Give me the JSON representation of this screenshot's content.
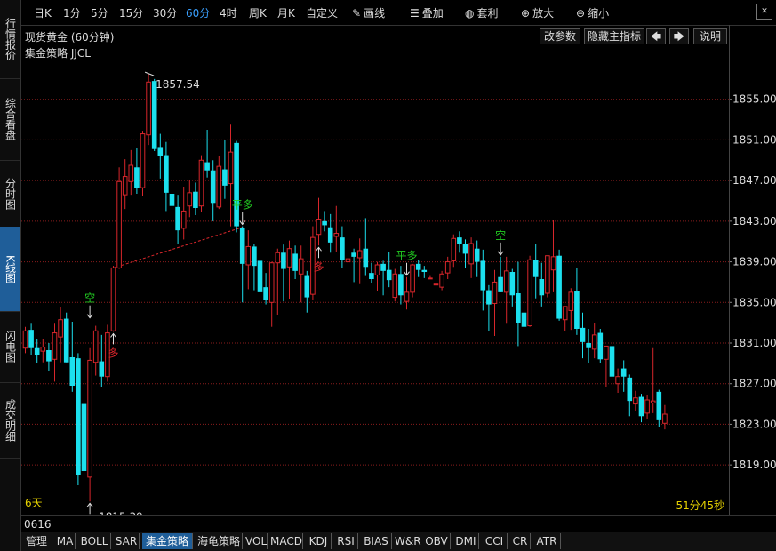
{
  "sidebar": {
    "tabs": [
      {
        "label": "行情报价",
        "active": false
      },
      {
        "label": "综合看盘",
        "active": false
      },
      {
        "label": "分时图",
        "active": false
      },
      {
        "label": "K线图",
        "active": true
      },
      {
        "label": "闪电图",
        "active": false
      },
      {
        "label": "成交明细",
        "active": false
      }
    ]
  },
  "toolbar": {
    "periods": [
      {
        "label": "日K",
        "active": false
      },
      {
        "label": "1分",
        "active": false
      },
      {
        "label": "5分",
        "active": false
      },
      {
        "label": "15分",
        "active": false
      },
      {
        "label": "30分",
        "active": false
      },
      {
        "label": "60分",
        "active": true
      },
      {
        "label": "4时",
        "active": false
      },
      {
        "label": "周K",
        "active": false
      },
      {
        "label": "月K",
        "active": false
      },
      {
        "label": "自定义",
        "active": false
      }
    ],
    "draw_label": "画线",
    "overlay_label": "叠加",
    "arbitrage_label": "套利",
    "zoom_in_label": "放大",
    "zoom_out_label": "缩小",
    "close_glyph": "✕"
  },
  "header": {
    "title": "现货黄金 (60分钟)",
    "modify_params": "改参数",
    "hide_main_indicator": "隐藏主指标",
    "prev_arrow": "🡄",
    "next_arrow": "🡆",
    "help": "说明"
  },
  "strategy_label": "集金策略 JJCL",
  "days_label": "6天",
  "timer_label": "51分45秒",
  "date_label": "0616",
  "bottom_tabs": [
    {
      "label": "管理",
      "active": false
    },
    {
      "label": "MA",
      "active": false
    },
    {
      "label": "BOLL",
      "active": false
    },
    {
      "label": "SAR",
      "active": false
    },
    {
      "label": "集金策略",
      "active": true
    },
    {
      "label": "海龟策略",
      "active": false
    },
    {
      "label": "VOL",
      "active": false
    },
    {
      "label": "MACD",
      "active": false
    },
    {
      "label": "KDJ",
      "active": false
    },
    {
      "label": "RSI",
      "active": false
    },
    {
      "label": "BIAS",
      "active": false
    },
    {
      "label": "W&R",
      "active": false
    },
    {
      "label": "OBV",
      "active": false
    },
    {
      "label": "DMI",
      "active": false
    },
    {
      "label": "CCI",
      "active": false
    },
    {
      "label": "CR",
      "active": false
    },
    {
      "label": "ATR",
      "active": false
    }
  ],
  "colors": {
    "up": "#d8262b",
    "down": "#1ce0ee",
    "signal_green": "#22cc22",
    "signal_red": "#d8262b",
    "grid": "#8a1c1c",
    "accent": "#3aa0ff",
    "timer": "#e6d200"
  },
  "chart_data": {
    "type": "candlestick",
    "y_ticks": [
      "1855.00",
      "1851.00",
      "1847.00",
      "1843.00",
      "1839.00",
      "1835.00",
      "1831.00",
      "1827.00",
      "1823.00",
      "1819.00"
    ],
    "y_tick_values": [
      1855,
      1851,
      1847,
      1843,
      1839,
      1835,
      1831,
      1827,
      1823,
      1819
    ],
    "ylim": [
      1814.2,
      1860.4
    ],
    "high_label": "1857.54",
    "low_label": "1815.39",
    "candles": [
      {
        "o": 1830.5,
        "h": 1832.6,
        "l": 1830.0,
        "c": 1832.2
      },
      {
        "o": 1832.3,
        "h": 1832.9,
        "l": 1829.8,
        "c": 1830.5
      },
      {
        "o": 1830.5,
        "h": 1831.4,
        "l": 1829.0,
        "c": 1829.8
      },
      {
        "o": 1830.2,
        "h": 1831.4,
        "l": 1829.1,
        "c": 1830.6
      },
      {
        "o": 1830.3,
        "h": 1831.0,
        "l": 1828.2,
        "c": 1829.2
      },
      {
        "o": 1829.4,
        "h": 1832.9,
        "l": 1827.2,
        "c": 1832.0
      },
      {
        "o": 1831.6,
        "h": 1834.5,
        "l": 1829.1,
        "c": 1833.3
      },
      {
        "o": 1833.4,
        "h": 1834.0,
        "l": 1829.1,
        "c": 1829.1
      },
      {
        "o": 1829.6,
        "h": 1833.1,
        "l": 1826.2,
        "c": 1826.8
      },
      {
        "o": 1829.5,
        "h": 1830.0,
        "l": 1817.0,
        "c": 1818.0
      },
      {
        "o": 1825.0,
        "h": 1825.4,
        "l": 1818.0,
        "c": 1818.4
      },
      {
        "o": 1817.8,
        "h": 1830.5,
        "l": 1815.4,
        "c": 1829.3
      },
      {
        "o": 1829.1,
        "h": 1832.7,
        "l": 1827.8,
        "c": 1832.2
      },
      {
        "o": 1829.2,
        "h": 1831.8,
        "l": 1826.7,
        "c": 1827.7
      },
      {
        "o": 1827.7,
        "h": 1832.8,
        "l": 1827.2,
        "c": 1832.0
      },
      {
        "o": 1832.2,
        "h": 1838.6,
        "l": 1832.1,
        "c": 1838.4
      },
      {
        "o": 1838.4,
        "h": 1848.3,
        "l": 1838.3,
        "c": 1846.9
      },
      {
        "o": 1845.6,
        "h": 1849.1,
        "l": 1844.2,
        "c": 1847.4
      },
      {
        "o": 1846.9,
        "h": 1850.0,
        "l": 1845.6,
        "c": 1848.5
      },
      {
        "o": 1848.3,
        "h": 1850.2,
        "l": 1845.7,
        "c": 1846.3
      },
      {
        "o": 1846.3,
        "h": 1851.9,
        "l": 1845.5,
        "c": 1851.6
      },
      {
        "o": 1851.5,
        "h": 1857.5,
        "l": 1850.5,
        "c": 1856.7
      },
      {
        "o": 1856.8,
        "h": 1857.0,
        "l": 1849.9,
        "c": 1850.1
      },
      {
        "o": 1850.3,
        "h": 1851.6,
        "l": 1847.2,
        "c": 1849.4
      },
      {
        "o": 1849.5,
        "h": 1850.8,
        "l": 1844.0,
        "c": 1845.8
      },
      {
        "o": 1845.7,
        "h": 1847.5,
        "l": 1842.0,
        "c": 1844.5
      },
      {
        "o": 1844.4,
        "h": 1845.6,
        "l": 1840.8,
        "c": 1842.1
      },
      {
        "o": 1842.3,
        "h": 1846.4,
        "l": 1841.2,
        "c": 1844.0
      },
      {
        "o": 1844.5,
        "h": 1847.0,
        "l": 1843.4,
        "c": 1845.8
      },
      {
        "o": 1845.9,
        "h": 1846.8,
        "l": 1843.6,
        "c": 1844.3
      },
      {
        "o": 1844.5,
        "h": 1849.5,
        "l": 1843.9,
        "c": 1849.0
      },
      {
        "o": 1848.8,
        "h": 1852.0,
        "l": 1847.3,
        "c": 1848.0
      },
      {
        "o": 1848.0,
        "h": 1849.0,
        "l": 1843.0,
        "c": 1844.8
      },
      {
        "o": 1844.4,
        "h": 1849.4,
        "l": 1844.2,
        "c": 1848.4
      },
      {
        "o": 1848.1,
        "h": 1851.0,
        "l": 1845.2,
        "c": 1846.5
      },
      {
        "o": 1846.7,
        "h": 1852.5,
        "l": 1842.5,
        "c": 1849.8
      },
      {
        "o": 1850.7,
        "h": 1850.9,
        "l": 1841.9,
        "c": 1842.5
      },
      {
        "o": 1842.3,
        "h": 1842.5,
        "l": 1835.0,
        "c": 1838.8
      },
      {
        "o": 1838.7,
        "h": 1842.1,
        "l": 1836.3,
        "c": 1840.5
      },
      {
        "o": 1840.5,
        "h": 1840.8,
        "l": 1836.2,
        "c": 1838.6
      },
      {
        "o": 1839.1,
        "h": 1840.4,
        "l": 1834.3,
        "c": 1836.0
      },
      {
        "o": 1836.5,
        "h": 1837.9,
        "l": 1834.8,
        "c": 1835.2
      },
      {
        "o": 1835.0,
        "h": 1839.0,
        "l": 1832.6,
        "c": 1838.9
      },
      {
        "o": 1838.9,
        "h": 1840.3,
        "l": 1833.8,
        "c": 1839.9
      },
      {
        "o": 1839.9,
        "h": 1840.7,
        "l": 1835.1,
        "c": 1838.3
      },
      {
        "o": 1838.5,
        "h": 1841.1,
        "l": 1835.3,
        "c": 1840.3
      },
      {
        "o": 1839.8,
        "h": 1840.6,
        "l": 1837.3,
        "c": 1838.1
      },
      {
        "o": 1837.8,
        "h": 1840.6,
        "l": 1835.0,
        "c": 1839.3
      },
      {
        "o": 1837.6,
        "h": 1838.1,
        "l": 1834.0,
        "c": 1835.5
      },
      {
        "o": 1835.8,
        "h": 1842.5,
        "l": 1835.2,
        "c": 1841.4
      },
      {
        "o": 1841.7,
        "h": 1845.3,
        "l": 1840.6,
        "c": 1843.2
      },
      {
        "o": 1843.0,
        "h": 1844.0,
        "l": 1842.0,
        "c": 1842.6
      },
      {
        "o": 1842.4,
        "h": 1843.7,
        "l": 1839.9,
        "c": 1840.9
      },
      {
        "o": 1841.5,
        "h": 1844.5,
        "l": 1840.0,
        "c": 1841.8
      },
      {
        "o": 1841.4,
        "h": 1842.5,
        "l": 1838.4,
        "c": 1839.2
      },
      {
        "o": 1839.0,
        "h": 1840.8,
        "l": 1837.3,
        "c": 1839.3
      },
      {
        "o": 1839.9,
        "h": 1840.3,
        "l": 1837.0,
        "c": 1839.5
      },
      {
        "o": 1839.4,
        "h": 1841.3,
        "l": 1836.8,
        "c": 1840.1
      },
      {
        "o": 1840.3,
        "h": 1843.3,
        "l": 1837.6,
        "c": 1838.5
      },
      {
        "o": 1837.9,
        "h": 1838.9,
        "l": 1836.9,
        "c": 1837.3
      },
      {
        "o": 1837.7,
        "h": 1839.0,
        "l": 1836.1,
        "c": 1838.7
      },
      {
        "o": 1838.8,
        "h": 1839.1,
        "l": 1835.7,
        "c": 1838.1
      },
      {
        "o": 1838.2,
        "h": 1840.0,
        "l": 1836.5,
        "c": 1837.2
      },
      {
        "o": 1835.5,
        "h": 1838.3,
        "l": 1835.1,
        "c": 1837.8
      },
      {
        "o": 1837.8,
        "h": 1838.6,
        "l": 1834.8,
        "c": 1835.7
      },
      {
        "o": 1835.1,
        "h": 1837.5,
        "l": 1834.3,
        "c": 1836.0
      },
      {
        "o": 1836.0,
        "h": 1838.8,
        "l": 1835.5,
        "c": 1838.7
      },
      {
        "o": 1838.8,
        "h": 1839.2,
        "l": 1837.5,
        "c": 1838.2
      },
      {
        "o": 1838.2,
        "h": 1838.6,
        "l": 1837.4,
        "c": 1838.0
      },
      {
        "o": 1837.4,
        "h": 1837.6,
        "l": 1837.3,
        "c": 1837.4
      },
      {
        "o": 1836.8,
        "h": 1837.1,
        "l": 1836.6,
        "c": 1836.8
      },
      {
        "o": 1836.5,
        "h": 1838.1,
        "l": 1836.2,
        "c": 1837.8
      },
      {
        "o": 1837.9,
        "h": 1839.5,
        "l": 1837.3,
        "c": 1839.0
      },
      {
        "o": 1839.1,
        "h": 1841.7,
        "l": 1838.5,
        "c": 1841.3
      },
      {
        "o": 1841.4,
        "h": 1842.0,
        "l": 1839.9,
        "c": 1840.8
      },
      {
        "o": 1840.8,
        "h": 1841.2,
        "l": 1838.4,
        "c": 1839.8
      },
      {
        "o": 1838.8,
        "h": 1841.4,
        "l": 1837.4,
        "c": 1840.8
      },
      {
        "o": 1840.3,
        "h": 1841.1,
        "l": 1837.5,
        "c": 1839.0
      },
      {
        "o": 1839.1,
        "h": 1840.2,
        "l": 1834.2,
        "c": 1836.2
      },
      {
        "o": 1836.2,
        "h": 1836.7,
        "l": 1832.2,
        "c": 1834.8
      },
      {
        "o": 1834.9,
        "h": 1838.2,
        "l": 1831.7,
        "c": 1837.0
      },
      {
        "o": 1837.5,
        "h": 1839.5,
        "l": 1836.0,
        "c": 1836.0
      },
      {
        "o": 1836.0,
        "h": 1839.5,
        "l": 1832.9,
        "c": 1838.1
      },
      {
        "o": 1838.0,
        "h": 1838.3,
        "l": 1834.6,
        "c": 1835.7
      },
      {
        "o": 1835.9,
        "h": 1839.0,
        "l": 1830.7,
        "c": 1833.0
      },
      {
        "o": 1834.0,
        "h": 1835.7,
        "l": 1832.6,
        "c": 1832.6
      },
      {
        "o": 1832.7,
        "h": 1839.6,
        "l": 1832.6,
        "c": 1839.2
      },
      {
        "o": 1839.2,
        "h": 1840.8,
        "l": 1835.4,
        "c": 1837.5
      },
      {
        "o": 1837.3,
        "h": 1838.9,
        "l": 1834.6,
        "c": 1835.7
      },
      {
        "o": 1835.9,
        "h": 1838.8,
        "l": 1835.5,
        "c": 1839.6
      },
      {
        "o": 1838.2,
        "h": 1843.1,
        "l": 1836.0,
        "c": 1839.5
      },
      {
        "o": 1839.6,
        "h": 1840.2,
        "l": 1833.2,
        "c": 1833.4
      },
      {
        "o": 1833.3,
        "h": 1834.4,
        "l": 1832.2,
        "c": 1834.6
      },
      {
        "o": 1834.2,
        "h": 1836.4,
        "l": 1832.3,
        "c": 1836.0
      },
      {
        "o": 1836.1,
        "h": 1838.4,
        "l": 1831.8,
        "c": 1832.4
      },
      {
        "o": 1832.5,
        "h": 1834.0,
        "l": 1829.5,
        "c": 1831.1
      },
      {
        "o": 1831.0,
        "h": 1832.4,
        "l": 1829.0,
        "c": 1830.5
      },
      {
        "o": 1830.4,
        "h": 1833.0,
        "l": 1829.5,
        "c": 1831.8
      },
      {
        "o": 1832.0,
        "h": 1832.4,
        "l": 1829.0,
        "c": 1829.4
      },
      {
        "o": 1829.4,
        "h": 1830.6,
        "l": 1826.7,
        "c": 1830.7
      },
      {
        "o": 1830.7,
        "h": 1831.3,
        "l": 1826.0,
        "c": 1827.7
      },
      {
        "o": 1827.0,
        "h": 1828.5,
        "l": 1826.1,
        "c": 1827.7
      },
      {
        "o": 1828.5,
        "h": 1829.3,
        "l": 1826.2,
        "c": 1827.7
      },
      {
        "o": 1827.6,
        "h": 1827.9,
        "l": 1823.8,
        "c": 1825.3
      },
      {
        "o": 1825.0,
        "h": 1826.3,
        "l": 1824.3,
        "c": 1825.6
      },
      {
        "o": 1825.7,
        "h": 1826.0,
        "l": 1823.2,
        "c": 1823.8
      },
      {
        "o": 1824.1,
        "h": 1825.9,
        "l": 1823.5,
        "c": 1825.4
      },
      {
        "o": 1825.1,
        "h": 1830.5,
        "l": 1824.1,
        "c": 1825.3
      },
      {
        "o": 1826.2,
        "h": 1826.4,
        "l": 1822.7,
        "c": 1823.4
      },
      {
        "o": 1823.1,
        "h": 1824.9,
        "l": 1822.5,
        "c": 1824.0
      }
    ],
    "signals": [
      {
        "label": "空",
        "index": 11,
        "position": "above_up",
        "color": "green",
        "arrow": "down"
      },
      {
        "label": "平空",
        "index": 11,
        "position": "below",
        "color": "red",
        "arrow": "up"
      },
      {
        "label": "多",
        "index": 15,
        "position": "below",
        "color": "red",
        "arrow": "up"
      },
      {
        "label": "平多",
        "index": 37,
        "position": "above",
        "color": "green",
        "arrow": "down"
      },
      {
        "label": "多",
        "index": 50,
        "position": "below",
        "color": "red",
        "arrow": "up"
      },
      {
        "label": "平多",
        "index": 65,
        "position": "above",
        "color": "green",
        "arrow": "down"
      },
      {
        "label": "空",
        "index": 81,
        "position": "above",
        "color": "green",
        "arrow": "down"
      }
    ],
    "trend_line": {
      "from_index": 15,
      "from_price": 1838.4,
      "to_index": 37,
      "to_price": 1842.4
    }
  }
}
